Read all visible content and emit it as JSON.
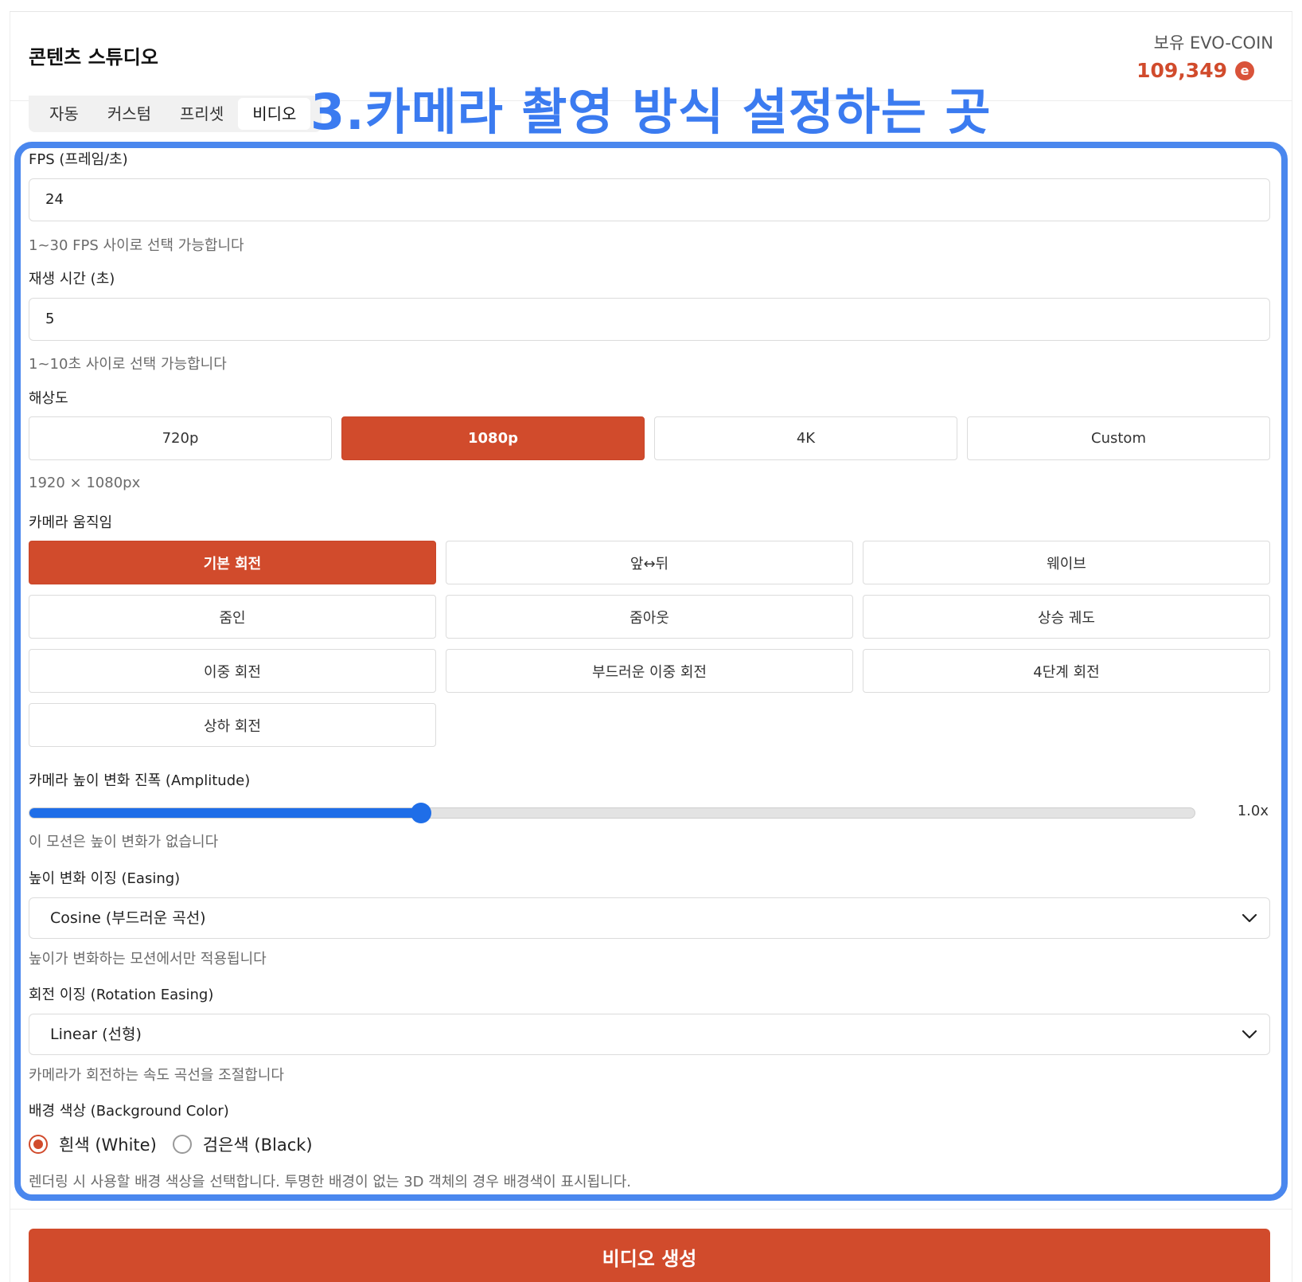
{
  "header": {
    "app_title": "콘텐츠 스튜디오",
    "coin_label": "보유 EVO-COIN",
    "coin_value": "109,349",
    "coin_icon": "e",
    "coin_color": "#d14b2c"
  },
  "tabs": [
    {
      "label": "자동",
      "active": false
    },
    {
      "label": "커스텀",
      "active": false
    },
    {
      "label": "프리셋",
      "active": false
    },
    {
      "label": "비디오",
      "active": true
    }
  ],
  "annotation": "3.카메라 촬영 방식 설정하는 곳",
  "form": {
    "fps": {
      "label": "FPS (프레임/초)",
      "value": "24",
      "hint": "1~30 FPS 사이로 선택 가능합니다"
    },
    "duration": {
      "label": "재생 시간 (초)",
      "value": "5",
      "hint": "1~10초 사이로 선택 가능합니다"
    },
    "resolution": {
      "label": "해상도",
      "options": [
        "720p",
        "1080p",
        "4K",
        "Custom"
      ],
      "selected": "1080p",
      "hint": "1920 × 1080px"
    },
    "camera_motion": {
      "label": "카메라 움직임",
      "options": [
        "기본 회전",
        "앞↔뒤",
        "웨이브",
        "줌인",
        "줌아웃",
        "상승 궤도",
        "이중 회전",
        "부드러운 이중 회전",
        "4단계 회전",
        "상하 회전"
      ],
      "selected": "기본 회전"
    },
    "amplitude": {
      "label": "카메라 높이 변화 진폭 (Amplitude)",
      "value_text": "1.0x",
      "fraction": 0.336,
      "hint": "이 모션은 높이 변화가 없습니다"
    },
    "easing": {
      "label": "높이 변화 이징 (Easing)",
      "selected": "Cosine (부드러운 곡선)",
      "hint": "높이가 변화하는 모션에서만 적용됩니다"
    },
    "rotation_easing": {
      "label": "회전 이징 (Rotation Easing)",
      "selected": "Linear (선형)",
      "hint": "카메라가 회전하는 속도 곡선을 조절합니다"
    },
    "background": {
      "label": "배경 색상 (Background Color)",
      "options": [
        {
          "label": "흰색 (White)",
          "checked": true
        },
        {
          "label": "검은색 (Black)",
          "checked": false
        }
      ],
      "hint": "렌더링 시 사용할 배경 색상을 선택합니다. 투명한 배경이 없는 3D 객체의 경우 배경색이 표시됩니다."
    }
  },
  "generate_button": "비디오 생성",
  "colors": {
    "accent": "#d14b2c",
    "annotation": "#3b7bf0",
    "slider": "#1f6ee8"
  },
  "icons": {
    "coin": "evo-coin-icon",
    "dropdown": "chevron-down-icon"
  }
}
